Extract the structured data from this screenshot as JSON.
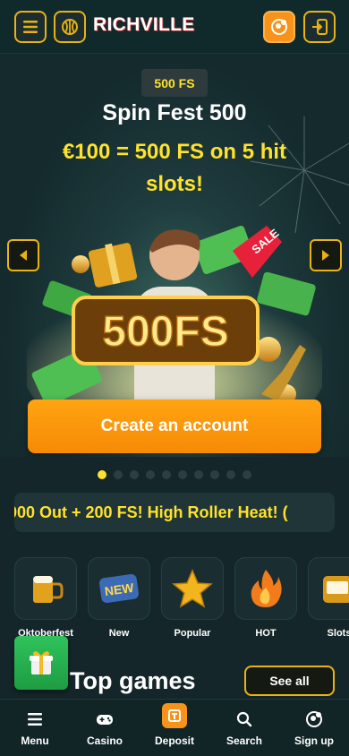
{
  "header": {
    "logo_text": "RICHVILLE",
    "menu_icon": "hamburger-icon",
    "logo_icon": "ball-icon",
    "profile_icon": "user-plus-icon",
    "login_icon": "login-icon",
    "accent_color": "#e9b213",
    "orange_color": "#f7931a"
  },
  "hero": {
    "badge": "500 FS",
    "title": "Spin Fest 500",
    "subtitle": "€100 = 500 FS on 5 hit slots!",
    "art_text": "500FS",
    "sale_tag": "SALE",
    "cta_label": "Create an account",
    "prev_icon": "arrow-left-icon",
    "next_icon": "arrow-right-icon",
    "slides_count": 10,
    "active_slide": 1
  },
  "ticker": {
    "text": "000 Out  + 200  FS!  High Roller Heat! ("
  },
  "categories": [
    {
      "label": "Oktoberfest",
      "icon": "beer-mug-icon"
    },
    {
      "label": "New",
      "icon": "new-badge-icon"
    },
    {
      "label": "Popular",
      "icon": "star-icon"
    },
    {
      "label": "HOT",
      "icon": "flame-icon"
    },
    {
      "label": "Slots",
      "icon": "slot-machine-icon"
    }
  ],
  "gift": {
    "icon": "gift-icon"
  },
  "sections": {
    "top_games_title": "Top games",
    "see_all_label": "See all"
  },
  "bottom_nav": [
    {
      "label": "Menu",
      "icon": "hamburger-icon"
    },
    {
      "label": "Casino",
      "icon": "gamepad-icon"
    },
    {
      "label": "Deposit",
      "icon": "deposit-icon"
    },
    {
      "label": "Search",
      "icon": "search-icon"
    },
    {
      "label": "Sign up",
      "icon": "user-plus-icon"
    }
  ]
}
